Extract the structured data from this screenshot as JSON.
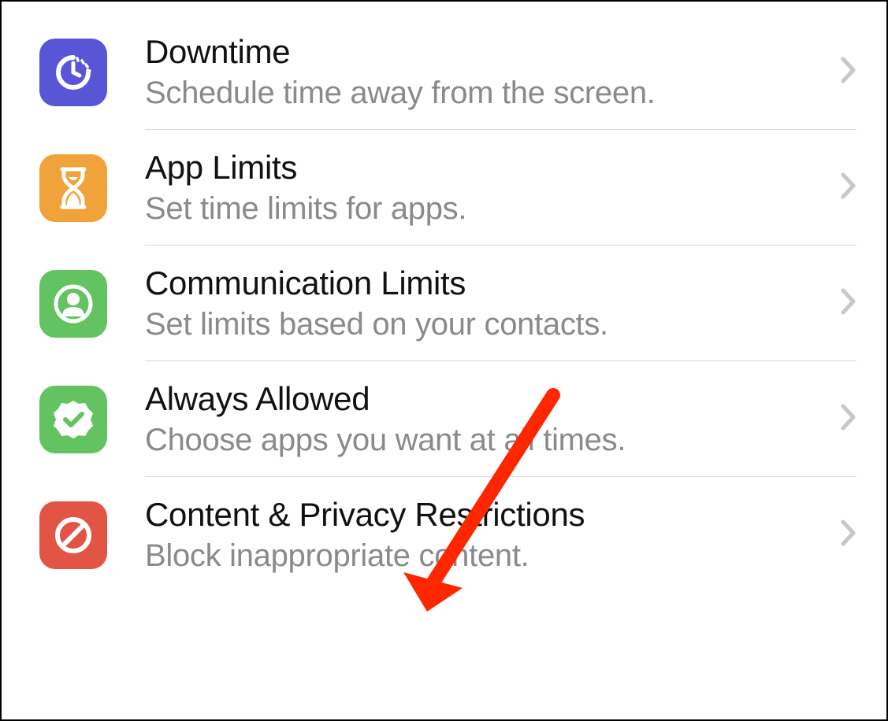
{
  "colors": {
    "downtime": "#5856d6",
    "appLimits": "#f0a33a",
    "communication": "#63c361",
    "alwaysAllowed": "#63c361",
    "contentPrivacy": "#e25444",
    "arrow": "#ff2600"
  },
  "items": [
    {
      "key": "downtime",
      "title": "Downtime",
      "subtitle": "Schedule time away from the screen."
    },
    {
      "key": "app-limits",
      "title": "App Limits",
      "subtitle": "Set time limits for apps."
    },
    {
      "key": "communication-limits",
      "title": "Communication Limits",
      "subtitle": "Set limits based on your contacts."
    },
    {
      "key": "always-allowed",
      "title": "Always Allowed",
      "subtitle": "Choose apps you want at all times."
    },
    {
      "key": "content-privacy",
      "title": "Content & Privacy Restrictions",
      "subtitle": "Block inappropriate content."
    }
  ]
}
